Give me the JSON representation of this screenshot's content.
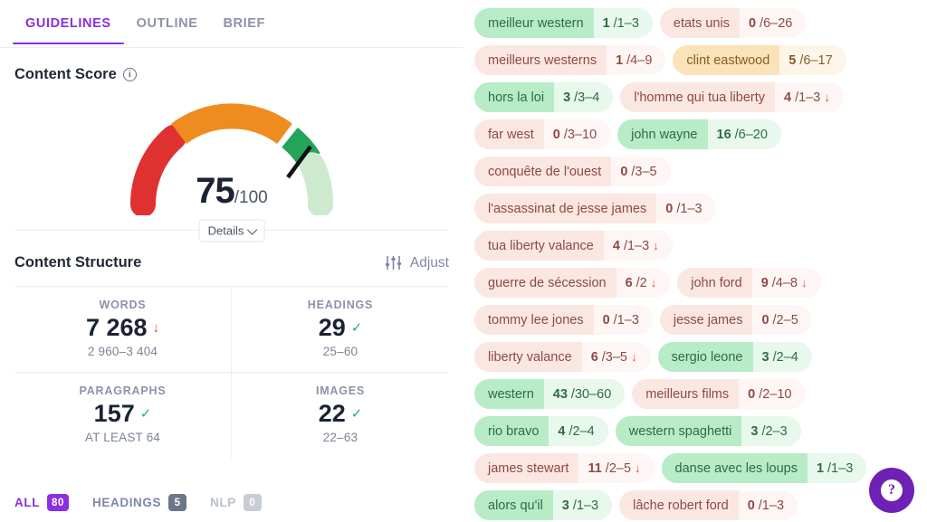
{
  "tabs": [
    {
      "label": "GUIDELINES",
      "active": true
    },
    {
      "label": "OUTLINE",
      "active": false
    },
    {
      "label": "BRIEF",
      "active": false
    }
  ],
  "content_score": {
    "title": "Content Score",
    "info_icon": "info-icon",
    "value": "75",
    "max": "/100",
    "details_label": "Details",
    "gauge": {
      "score": 75,
      "min": 0,
      "max": 100,
      "segments": [
        {
          "name": "poor",
          "from": 0,
          "to": 33,
          "color": "#e03131"
        },
        {
          "name": "average",
          "from": 33,
          "to": 66,
          "color": "#ef8c1f"
        },
        {
          "name": "good",
          "from": 66,
          "to": 78,
          "color": "#24a35a"
        },
        {
          "name": "remaining",
          "from": 78,
          "to": 100,
          "color": "#cdeacf"
        }
      ],
      "needle_color": "#111111"
    }
  },
  "content_structure": {
    "title": "Content Structure",
    "adjust_label": "Adjust",
    "adjust_icon": "sliders-icon",
    "stats": [
      {
        "label": "WORDS",
        "value": "7 268",
        "status": "down",
        "range": "2 960–3 404"
      },
      {
        "label": "HEADINGS",
        "value": "29",
        "status": "ok",
        "range": "25–60"
      },
      {
        "label": "PARAGRAPHS",
        "value": "157",
        "status": "ok",
        "range": "AT LEAST 64"
      },
      {
        "label": "IMAGES",
        "value": "22",
        "status": "ok",
        "range": "22–63"
      }
    ]
  },
  "filters": [
    {
      "label": "ALL",
      "count": "80",
      "state": "active"
    },
    {
      "label": "HEADINGS",
      "count": "5",
      "state": "normal"
    },
    {
      "label": "NLP",
      "count": "0",
      "state": "muted"
    }
  ],
  "keyword_rows": [
    [
      {
        "term": "meilleur western",
        "count": "1/1–3",
        "variant": "green",
        "down": false
      },
      {
        "term": "etats unis",
        "count": "0/6–26",
        "variant": "red",
        "down": false
      }
    ],
    [
      {
        "term": "meilleurs westerns",
        "count": "1/4–9",
        "variant": "red",
        "down": false
      },
      {
        "term": "clint eastwood",
        "count": "5/6–17",
        "variant": "amber",
        "down": false
      }
    ],
    [
      {
        "term": "hors la loi",
        "count": "3/3–4",
        "variant": "green",
        "down": false
      },
      {
        "term": "l'homme qui tua liberty",
        "count": "4/1–3",
        "variant": "red",
        "down": true
      }
    ],
    [
      {
        "term": "far west",
        "count": "0/3–10",
        "variant": "red",
        "down": false
      },
      {
        "term": "john wayne",
        "count": "16/6–20",
        "variant": "green",
        "down": false
      }
    ],
    [
      {
        "term": "conquête de l'ouest",
        "count": "0/3–5",
        "variant": "red",
        "down": false
      }
    ],
    [
      {
        "term": "l'assassinat de jesse james",
        "count": "0/1–3",
        "variant": "red",
        "down": false
      }
    ],
    [
      {
        "term": "tua liberty valance",
        "count": "4/1–3",
        "variant": "red",
        "down": true
      }
    ],
    [
      {
        "term": "guerre de sécession",
        "count": "6/2",
        "variant": "red",
        "down": true
      },
      {
        "term": "john ford",
        "count": "9/4–8",
        "variant": "red",
        "down": true
      }
    ],
    [
      {
        "term": "tommy lee jones",
        "count": "0/1–3",
        "variant": "red",
        "down": false
      },
      {
        "term": "jesse james",
        "count": "0/2–5",
        "variant": "red",
        "down": false
      }
    ],
    [
      {
        "term": "liberty valance",
        "count": "6/3–5",
        "variant": "red",
        "down": true
      },
      {
        "term": "sergio leone",
        "count": "3/2–4",
        "variant": "green",
        "down": false
      }
    ],
    [
      {
        "term": "western",
        "count": "43/30–60",
        "variant": "green",
        "down": false
      },
      {
        "term": "meilleurs films",
        "count": "0/2–10",
        "variant": "red",
        "down": false
      }
    ],
    [
      {
        "term": "rio bravo",
        "count": "4/2–4",
        "variant": "green",
        "down": false
      },
      {
        "term": "western spaghetti",
        "count": "3/2–3",
        "variant": "green",
        "down": false
      }
    ],
    [
      {
        "term": "james stewart",
        "count": "11/2–5",
        "variant": "red",
        "down": true
      },
      {
        "term": "danse avec les loups",
        "count": "1/1–3",
        "variant": "green",
        "down": false
      }
    ],
    [
      {
        "term": "alors qu'il",
        "count": "3/1–3",
        "variant": "green",
        "down": false
      },
      {
        "term": "lâche robert ford",
        "count": "0/1–3",
        "variant": "red",
        "down": false
      }
    ]
  ],
  "help_button": {
    "icon": "question-mark-icon",
    "label": "?"
  },
  "colors": {
    "accent_purple": "#8b2fe0",
    "fab_purple": "#6d21b5",
    "gauge_red": "#e03131",
    "gauge_orange": "#ef8c1f",
    "gauge_green": "#24a35a",
    "gauge_light_green": "#cdeacf",
    "status_down": "#ef4444",
    "status_ok": "#27ae60"
  }
}
